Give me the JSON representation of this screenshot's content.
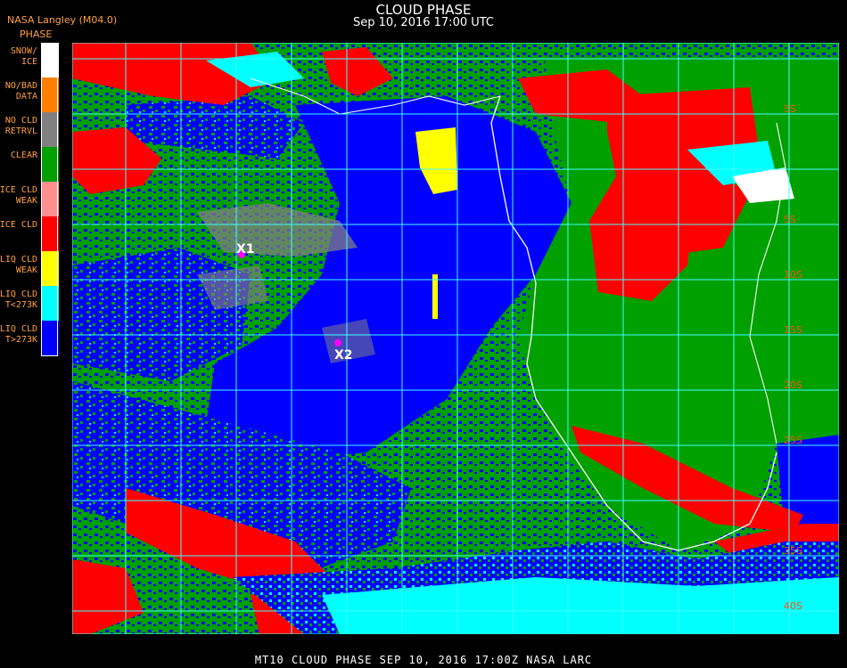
{
  "header": {
    "source": "NASA Langley (M04.0)",
    "legend_title": "PHASE",
    "title": "CLOUD PHASE",
    "subtitle": "Sep 10, 2016 17:00 UTC"
  },
  "legend": [
    {
      "label": "SNOW/\nICE",
      "color": "#ffffff",
      "name": "snow-ice"
    },
    {
      "label": "NO/BAD\nDATA",
      "color": "#ff8000",
      "name": "no-bad-data"
    },
    {
      "label": "NO CLD\nRETRVL",
      "color": "#808080",
      "name": "no-cld-retrvl"
    },
    {
      "label": "CLEAR",
      "color": "#00a000",
      "name": "clear"
    },
    {
      "label": "ICE CLD\nWEAK",
      "color": "#ff9090",
      "name": "ice-cld-weak"
    },
    {
      "label": "ICE CLD",
      "color": "#ff0000",
      "name": "ice-cld"
    },
    {
      "label": "LIQ CLD\nWEAK",
      "color": "#ffff00",
      "name": "liq-cld-weak"
    },
    {
      "label": "LIQ CLD\nT<273K",
      "color": "#00ffff",
      "name": "liq-cld-cold"
    },
    {
      "label": "LIQ CLD\nT>273K",
      "color": "#0000ff",
      "name": "liq-cld-warm"
    }
  ],
  "markers": [
    {
      "label": "X1",
      "name": "marker-x1"
    },
    {
      "label": "X2",
      "name": "marker-x2"
    }
  ],
  "lat_labels": [
    "5S",
    "5S",
    "10S",
    "15S",
    "20S",
    "25S",
    "35S",
    "40S"
  ],
  "footer": "MT10  CLOUD PHASE   SEP 10, 2016 17:00Z   NASA LARC"
}
